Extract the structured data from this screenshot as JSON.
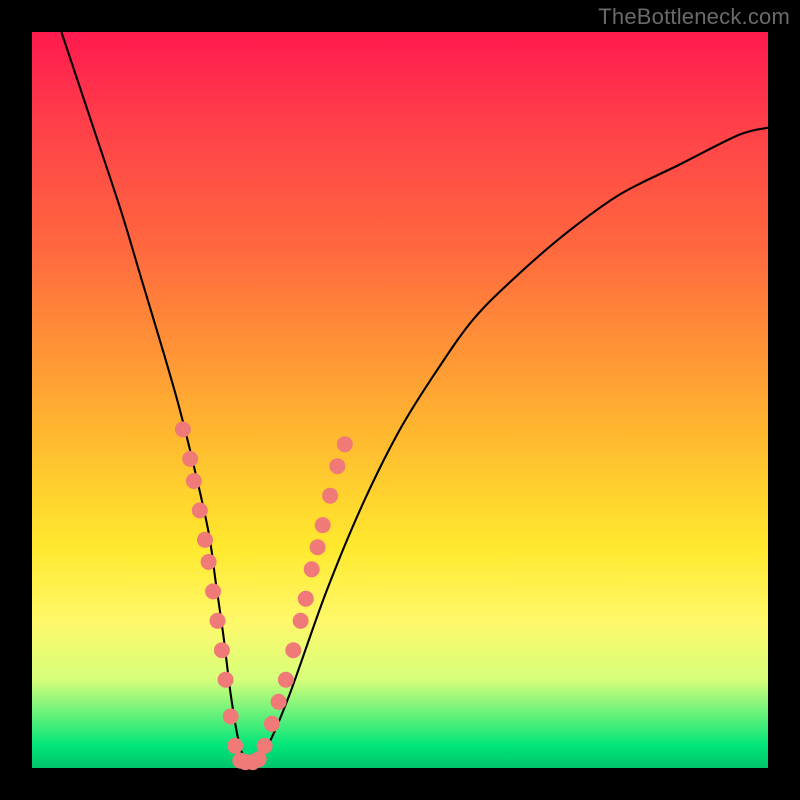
{
  "watermark": "TheBottleneck.com",
  "colors": {
    "frame": "#000000",
    "gradient_top": "#ff1a4e",
    "gradient_bottom": "#00c46b",
    "curve": "#000000",
    "dots": "#ef7a78"
  },
  "chart_data": {
    "type": "line",
    "title": "",
    "xlabel": "",
    "ylabel": "",
    "xlim": [
      0,
      100
    ],
    "ylim": [
      0,
      100
    ],
    "grid": false,
    "legend": false,
    "annotations": [
      "TheBottleneck.com"
    ],
    "series": [
      {
        "name": "bottleneck-curve",
        "x": [
          4,
          8,
          12,
          15,
          18,
          20,
          22,
          24,
          25,
          26,
          27,
          28,
          29,
          30,
          32,
          35,
          40,
          45,
          50,
          55,
          60,
          66,
          73,
          80,
          88,
          96,
          100
        ],
        "y": [
          100,
          88,
          76,
          66,
          56,
          49,
          41,
          32,
          25,
          18,
          10,
          4,
          1,
          1,
          3,
          10,
          24,
          36,
          46,
          54,
          61,
          67,
          73,
          78,
          82,
          86,
          87
        ]
      }
    ],
    "markers": [
      {
        "name": "highlight-dots",
        "points": [
          {
            "x": 20.5,
            "y": 46
          },
          {
            "x": 21.5,
            "y": 42
          },
          {
            "x": 22.0,
            "y": 39
          },
          {
            "x": 22.8,
            "y": 35
          },
          {
            "x": 23.5,
            "y": 31
          },
          {
            "x": 24.0,
            "y": 28
          },
          {
            "x": 24.6,
            "y": 24
          },
          {
            "x": 25.2,
            "y": 20
          },
          {
            "x": 25.8,
            "y": 16
          },
          {
            "x": 26.3,
            "y": 12
          },
          {
            "x": 27.0,
            "y": 7
          },
          {
            "x": 27.6,
            "y": 3
          },
          {
            "x": 28.3,
            "y": 1
          },
          {
            "x": 29.0,
            "y": 0.8
          },
          {
            "x": 30.0,
            "y": 0.8
          },
          {
            "x": 30.8,
            "y": 1.2
          },
          {
            "x": 31.6,
            "y": 3
          },
          {
            "x": 32.6,
            "y": 6
          },
          {
            "x": 33.5,
            "y": 9
          },
          {
            "x": 34.5,
            "y": 12
          },
          {
            "x": 35.5,
            "y": 16
          },
          {
            "x": 36.5,
            "y": 20
          },
          {
            "x": 37.2,
            "y": 23
          },
          {
            "x": 38.0,
            "y": 27
          },
          {
            "x": 38.8,
            "y": 30
          },
          {
            "x": 39.5,
            "y": 33
          },
          {
            "x": 40.5,
            "y": 37
          },
          {
            "x": 41.5,
            "y": 41
          },
          {
            "x": 42.5,
            "y": 44
          }
        ]
      }
    ]
  }
}
